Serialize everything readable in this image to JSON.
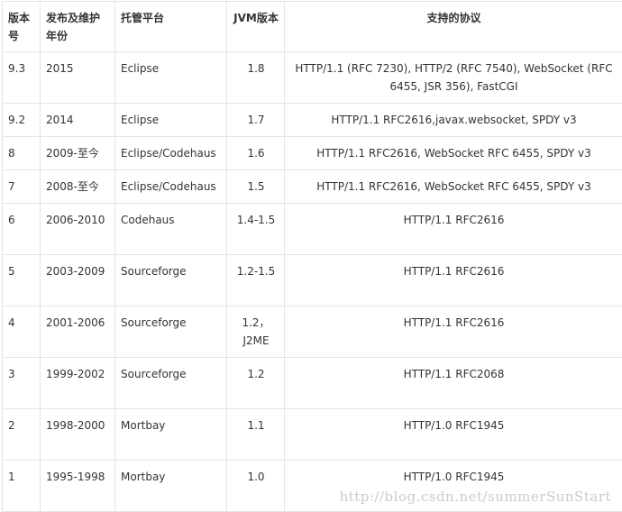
{
  "table": {
    "headers": [
      "版本号",
      "发布及维护年份",
      "托管平台",
      "JVM版本",
      "支持的协议"
    ],
    "rows": [
      {
        "version": "9.3",
        "years": "2015",
        "host": "Eclipse",
        "jvm": "1.8",
        "protocols": "HTTP/1.1 (RFC 7230), HTTP/2 (RFC 7540), WebSocket (RFC 6455, JSR 356), FastCGI"
      },
      {
        "version": "9.2",
        "years": "2014",
        "host": "Eclipse",
        "jvm": "1.7",
        "protocols": "HTTP/1.1 RFC2616,javax.websocket, SPDY v3"
      },
      {
        "version": "8",
        "years": "2009-至今",
        "host": "Eclipse/Codehaus",
        "jvm": "1.6",
        "protocols": "HTTP/1.1 RFC2616, WebSocket RFC 6455, SPDY v3"
      },
      {
        "version": "7",
        "years": "2008-至今",
        "host": "Eclipse/Codehaus",
        "jvm": "1.5",
        "protocols": "HTTP/1.1 RFC2616, WebSocket RFC 6455, SPDY v3"
      },
      {
        "version": "6",
        "years": "2006-2010",
        "host": "Codehaus",
        "jvm": "1.4-1.5",
        "protocols": "HTTP/1.1 RFC2616"
      },
      {
        "version": "5",
        "years": "2003-2009",
        "host": "Sourceforge",
        "jvm": "1.2-1.5",
        "protocols": "HTTP/1.1 RFC2616"
      },
      {
        "version": "4",
        "years": "2001-2006",
        "host": "Sourceforge",
        "jvm": "1.2，J2ME",
        "protocols": "HTTP/1.1 RFC2616"
      },
      {
        "version": "3",
        "years": "1999-2002",
        "host": "Sourceforge",
        "jvm": "1.2",
        "protocols": "HTTP/1.1 RFC2068"
      },
      {
        "version": "2",
        "years": "1998-2000",
        "host": "Mortbay",
        "jvm": "1.1",
        "protocols": "HTTP/1.0 RFC1945"
      },
      {
        "version": "1",
        "years": "1995-1998",
        "host": "Mortbay",
        "jvm": "1.0",
        "protocols": "HTTP/1.0 RFC1945"
      }
    ]
  },
  "watermark": "http://blog.csdn.net/summerSunStart"
}
